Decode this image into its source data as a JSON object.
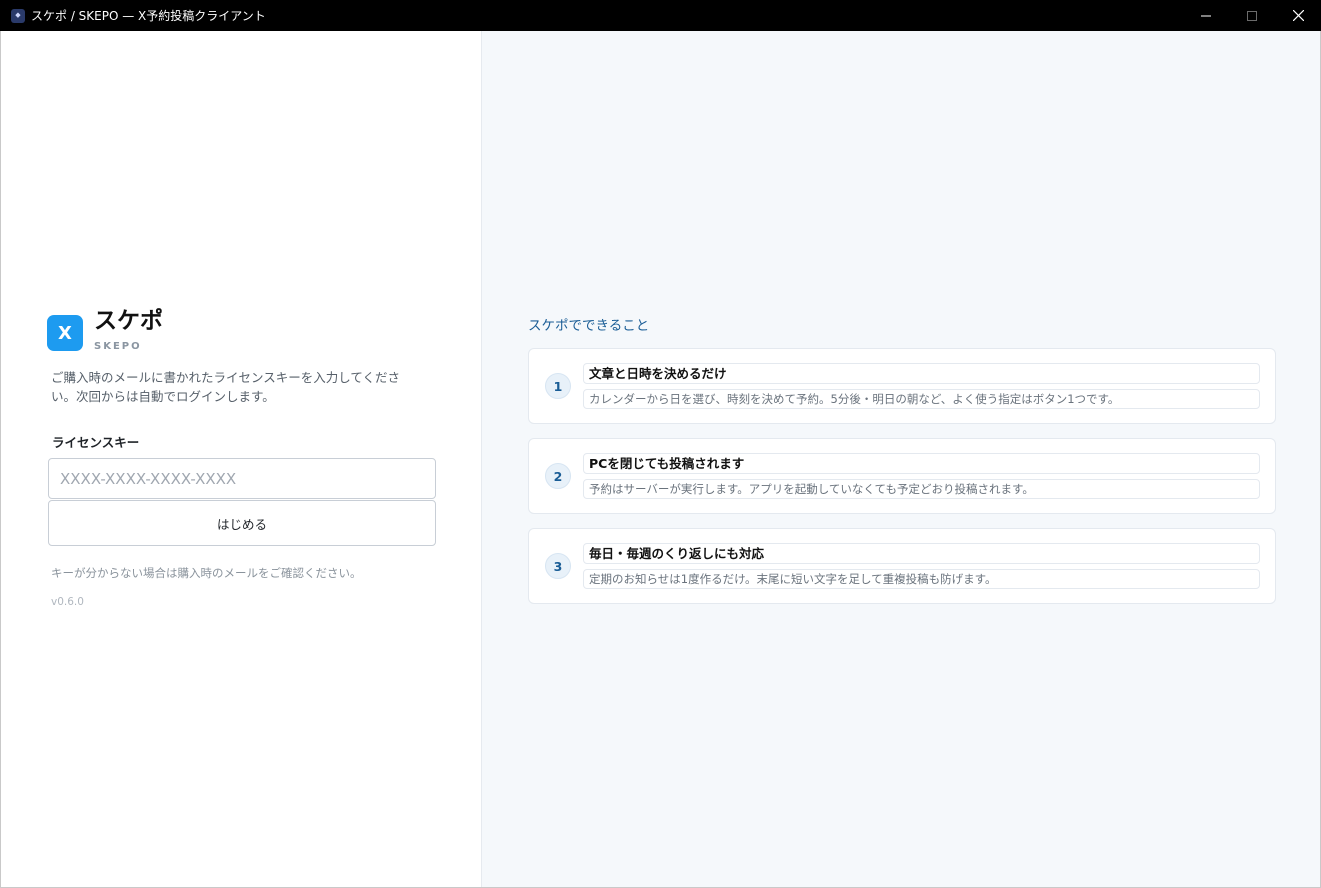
{
  "window": {
    "title": "スケポ / SKEPO — X予約投稿クライアント",
    "minimize_label": "—",
    "maximize_label": "☐",
    "close_label": "✕"
  },
  "brand": {
    "logo_letter": "X",
    "name": "スケポ",
    "sub": "SKEPO"
  },
  "login": {
    "intro": "ご購入時のメールに書かれたライセンスキーを入力してください。次回からは自動でログインします。",
    "license_label": "ライセンスキー",
    "license_value": "",
    "license_placeholder": "XXXX-XXXX-XXXX-XXXX",
    "start_button": "はじめる",
    "help_text": "キーが分からない場合は購入時のメールをご確認ください。",
    "version": "v0.6.0"
  },
  "features": {
    "title": "スケポでできること",
    "items": [
      {
        "num": "1",
        "title": "文章と日時を決めるだけ",
        "desc": "カレンダーから日を選び、時刻を決めて予約。5分後・明日の朝など、よく使う指定はボタン1つです。"
      },
      {
        "num": "2",
        "title": "PCを閉じても投稿されます",
        "desc": "予約はサーバーが実行します。アプリを起動していなくても予定どおり投稿されます。"
      },
      {
        "num": "3",
        "title": "毎日・毎週のくり返しにも対応",
        "desc": "定期のお知らせは1度作るだけ。末尾に短い文字を足して重複投稿も防げます。"
      }
    ]
  },
  "colors": {
    "accent": "#1d9bf0",
    "heading_blue": "#1a5d96",
    "right_bg": "#f5f8fb"
  }
}
